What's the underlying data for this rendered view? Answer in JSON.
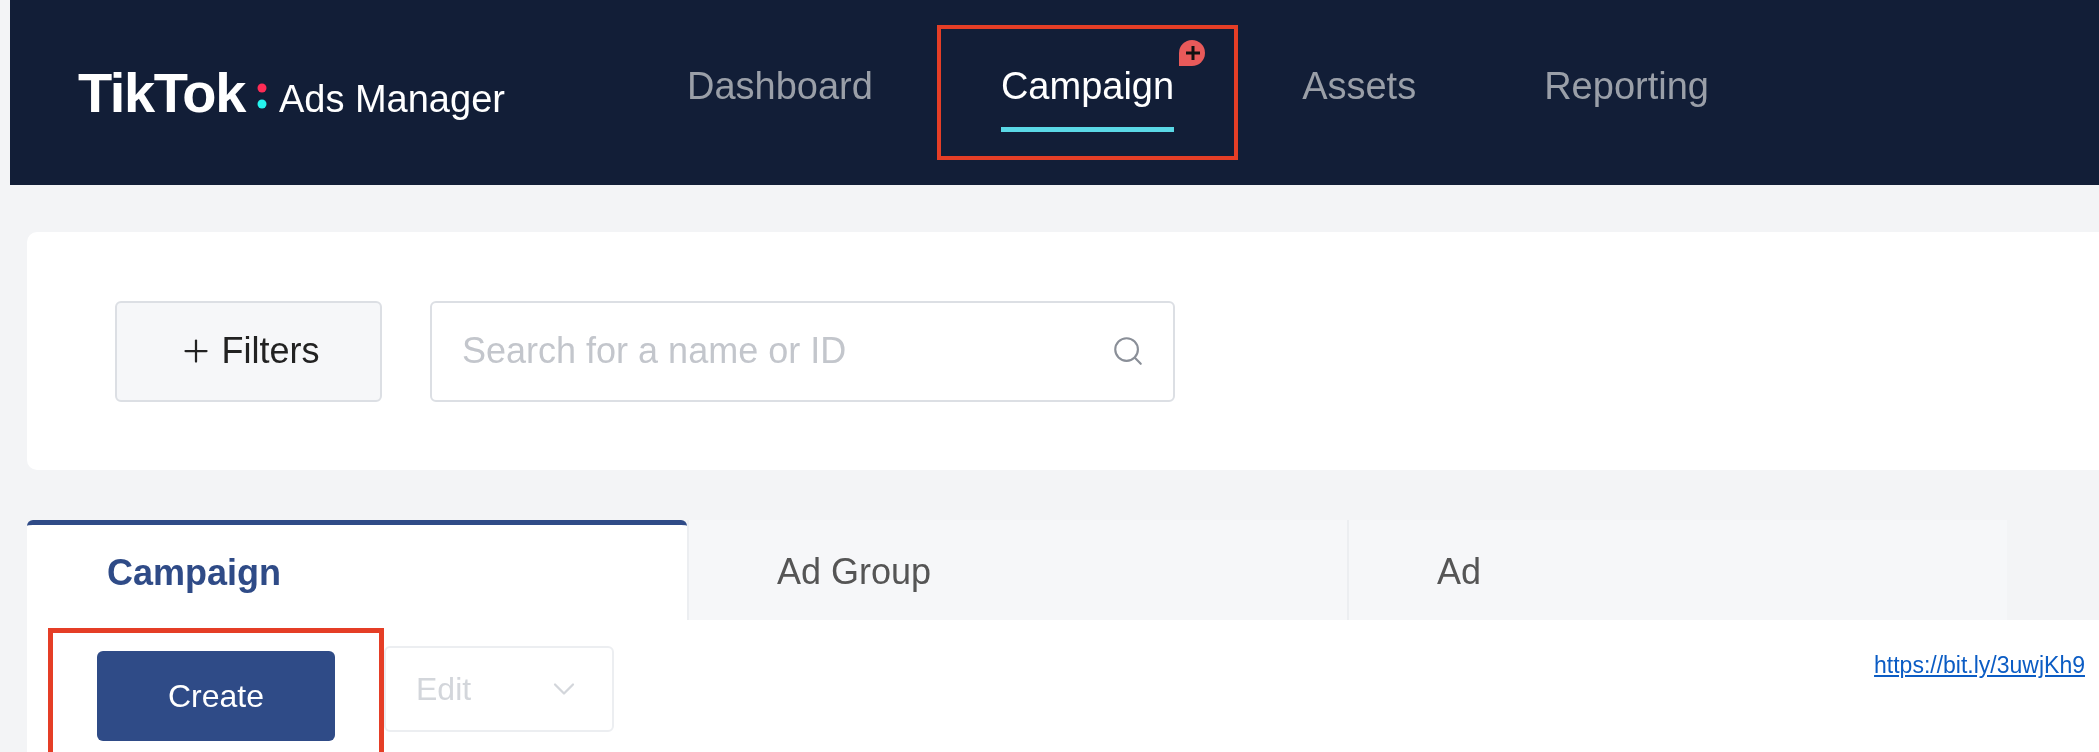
{
  "header": {
    "logo": "TikTok",
    "logo_sub": "Ads Manager"
  },
  "nav": [
    {
      "label": "Dashboard",
      "selected": false,
      "highlighted": false,
      "badge": false
    },
    {
      "label": "Campaign",
      "selected": true,
      "highlighted": true,
      "badge": true
    },
    {
      "label": "Assets",
      "selected": false,
      "highlighted": false,
      "badge": false
    },
    {
      "label": "Reporting",
      "selected": false,
      "highlighted": false,
      "badge": false
    }
  ],
  "filters": {
    "label": "Filters"
  },
  "search": {
    "placeholder": "Search for a name or ID"
  },
  "tabs": [
    {
      "label": "Campaign",
      "selected": true
    },
    {
      "label": "Ad Group",
      "selected": false
    },
    {
      "label": "Ad",
      "selected": false
    }
  ],
  "actions": [
    {
      "label": "Create",
      "kind": "primary",
      "disabled": false,
      "highlighted": true
    },
    {
      "label": "Edit",
      "kind": "dropdown",
      "disabled": true,
      "highlighted": false
    }
  ],
  "link": "https://bit.ly/3uwjKh9"
}
